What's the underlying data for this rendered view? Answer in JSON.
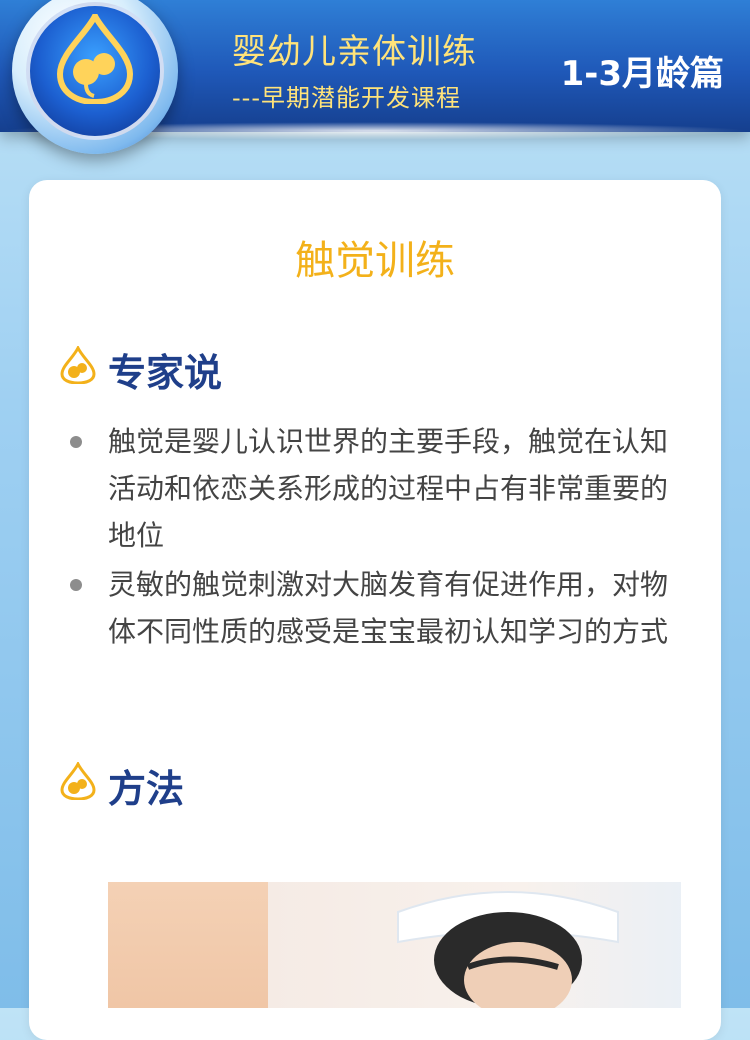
{
  "header": {
    "title": "婴幼儿亲体训练",
    "subtitle": "---早期潜能开发课程",
    "age_label": "1-3月龄篇"
  },
  "content": {
    "title": "触觉训练",
    "expert_section": {
      "heading": "专家说",
      "bullets": [
        "触觉是婴儿认识世界的主要手段，触觉在认知活动和依恋关系形成的过程中占有非常重要的地位",
        "灵敏的触觉刺激对大脑发育有促进作用，对物体不同性质的感受是宝宝最初认知学习的方式"
      ]
    },
    "method_section": {
      "heading": "方法"
    }
  },
  "colors": {
    "header_blue": "#1f58b8",
    "title_gold": "#f3b11a",
    "section_blue": "#1f3f8a",
    "text_gray": "#444444"
  },
  "icons": {
    "logo": "drop-logo-icon",
    "section": "drop-bullet-icon"
  }
}
